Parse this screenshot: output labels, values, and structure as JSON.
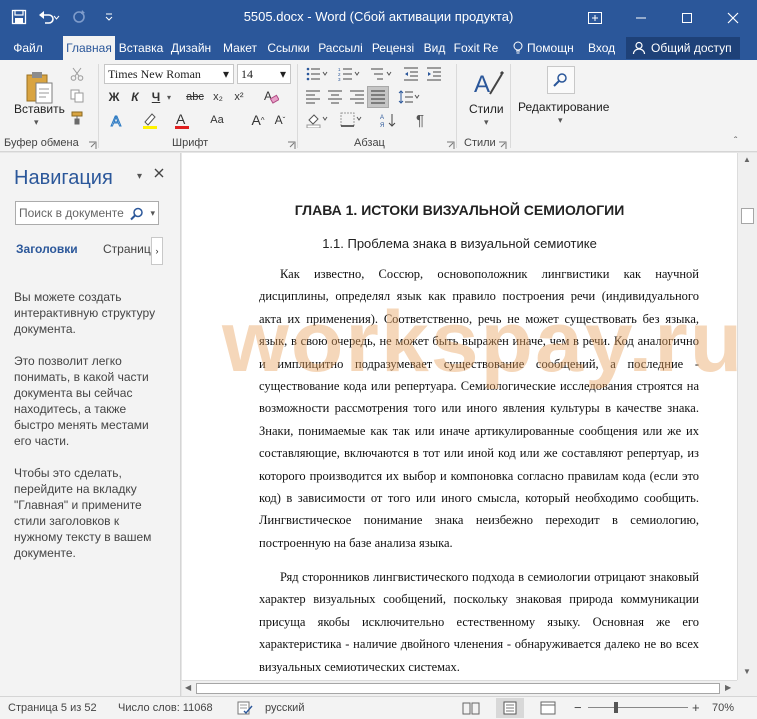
{
  "window": {
    "title": "5505.docx - Word (Сбой активации продукта)"
  },
  "tabs": {
    "file": "Файл",
    "items": [
      "Главная",
      "Вставка",
      "Дизайн",
      "Макет",
      "Ссылки",
      "Рассылі",
      "Рецензі",
      "Вид",
      "Foxit Re"
    ],
    "active_index": 0,
    "tell_me": "Помощн",
    "sign_in": "Вход",
    "share": "Общий доступ"
  },
  "ribbon": {
    "paste_label": "Вставить",
    "clipboard_label": "Буфер обмена",
    "font_name": "Times New Roman",
    "font_size": "14",
    "font_group_label": "Шрифт",
    "paragraph_group_label": "Абзац",
    "styles_button": "Стили",
    "styles_group_label": "Стили",
    "editing_button": "Редактирование",
    "format_buttons": {
      "bold": "Ж",
      "italic": "К",
      "underline": "Ч",
      "strike": "abc",
      "subscript": "x₂",
      "superscript": "x²"
    }
  },
  "navigation": {
    "title": "Навигация",
    "search_placeholder": "Поиск в документе",
    "tab_headings": "Заголовки",
    "tab_pages": "Страниц",
    "text1": "Вы можете создать интерактивную структуру документа.",
    "text2": "Это позволит легко понимать, в какой части документа вы сейчас находитесь, а также быстро менять местами его части.",
    "text3": "Чтобы это сделать, перейдите на вкладку \"Главная\" и примените стили заголовков к нужному тексту в вашем документе."
  },
  "document": {
    "chapter": "ГЛАВА 1. ИСТОКИ ВИЗУАЛЬНОЙ СЕМИОЛОГИИ",
    "section": "1.1.   Проблема знака в визуальной семиотике",
    "para1": "Как известно, Соссюр, основоположник лингвистики как научной дисциплины, определял язык как правило построения речи (индивидуального акта их применения). Соответственно, речь не может существовать без языка, язык, в свою очередь, не может быть выражен иначе, чем в речи. Код аналогично и имплицитно подразумевает существование сообщений, а последние - существование кода или репертуара. Семиологические исследования строятся на возможности рассмотрения того или иного явления культуры в качестве знака. Знаки, понимаемые как так или иначе артикулированные сообщения или же их составляющие, включаются в тот или иной код или же составляют репертуар, из которого производится их выбор и компоновка согласно правилам кода (если это код) в зависимости от того или иного смысла, который необходимо сообщить. Лингвистическое понимание знака неизбежно переходит в семиологию, построенную на базе анализа языка.",
    "para2": "Ряд сторонников лингвистического подхода в семиологии отрицают знаковый характер визуальных сообщений, поскольку знаковая природа коммуникации присуща якобы исключительно естественному языку. Основная же его характеристика - наличие двойного членения - обнаруживается далеко не во всех визуальных семиотических системах.",
    "watermark": "workspay.ru"
  },
  "status": {
    "page": "Страница 5 из 52",
    "words": "Число слов: 11068",
    "language": "русский",
    "zoom": "70%"
  },
  "colors": {
    "accent": "#2b579a"
  }
}
